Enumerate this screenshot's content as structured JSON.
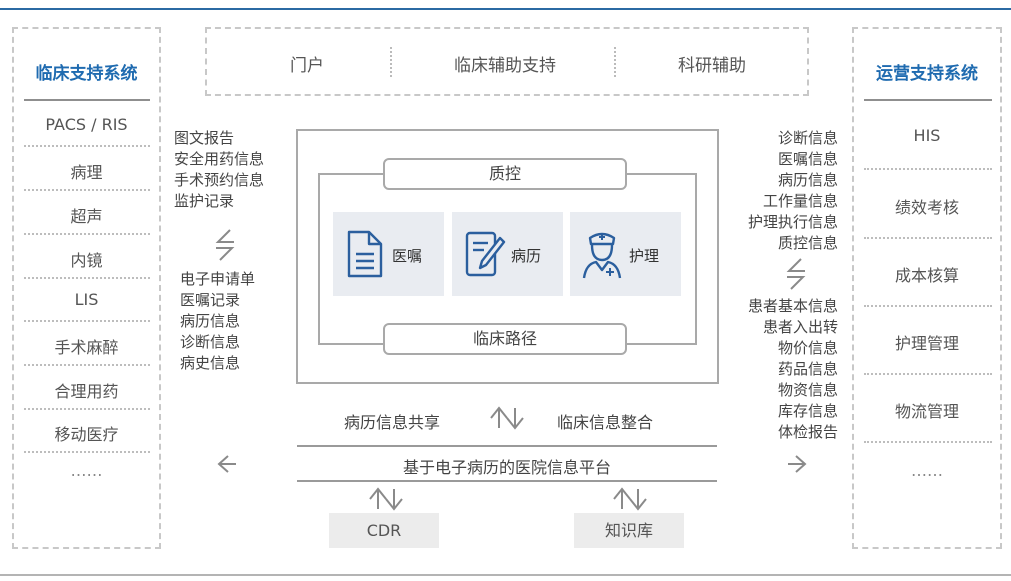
{
  "left_panel": {
    "title": "临床支持系统",
    "items": [
      "PACS / RIS",
      "病理",
      "超声",
      "内镜",
      "LIS",
      "手术麻醉",
      "合理用药",
      "移动医疗",
      "……"
    ]
  },
  "right_panel": {
    "title": "运营支持系统",
    "items": [
      "HIS",
      "绩效考核",
      "成本核算",
      "护理管理",
      "物流管理",
      "……"
    ]
  },
  "top_bar": {
    "items": [
      "门户",
      "临床辅助支持",
      "科研辅助"
    ]
  },
  "left_lists": {
    "incoming": [
      "图文报告",
      "安全用药信息",
      "手术预约信息",
      "监护记录"
    ],
    "outgoing": [
      "电子申请单",
      "医嘱记录",
      "病历信息",
      "诊断信息",
      "病史信息"
    ]
  },
  "right_lists": {
    "upper": [
      "诊断信息",
      "医嘱信息",
      "病历信息",
      "工作量信息",
      "护理执行信息",
      "质控信息"
    ],
    "lower": [
      "患者基本信息",
      "患者入出转",
      "物价信息",
      "药品信息",
      "物资信息",
      "库存信息",
      "体检报告"
    ]
  },
  "center": {
    "top_label": "质控",
    "bottom_label": "临床路径",
    "modules": [
      {
        "label": "医嘱",
        "icon": "document-icon"
      },
      {
        "label": "病历",
        "icon": "edit-record-icon"
      },
      {
        "label": "护理",
        "icon": "nurse-icon"
      }
    ]
  },
  "platform": {
    "share_label": "病历信息共享",
    "integrate_label": "临床信息整合",
    "title": "基于电子病历的医院信息平台",
    "stores": [
      "CDR",
      "知识库"
    ]
  },
  "colors": {
    "accent": "#1f6bb0",
    "icon": "#2b5f9e",
    "module_bg": "#e9ecf1"
  }
}
